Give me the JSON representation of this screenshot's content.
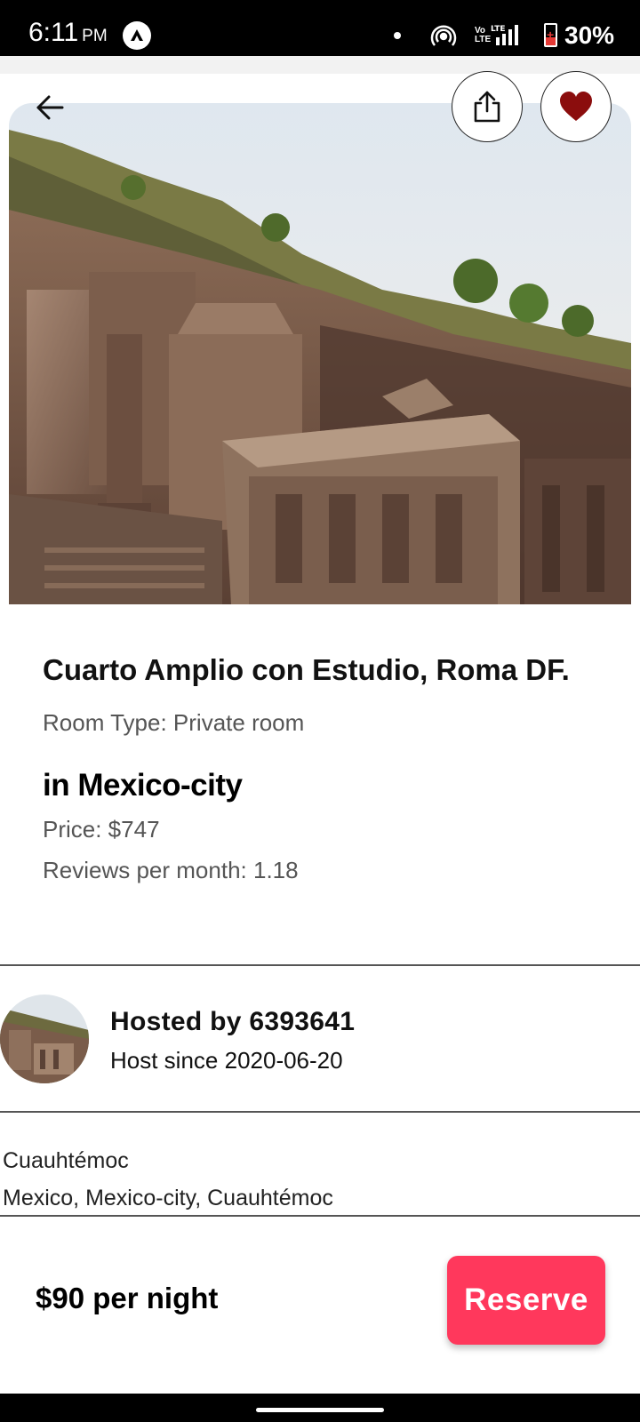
{
  "status_bar": {
    "time": "6:11",
    "ampm": "PM",
    "network": "LTE",
    "volte": "Vo LTE",
    "battery": "30%"
  },
  "header": {
    "back_icon": "arrow-left-icon",
    "share_icon": "share-icon",
    "favorite_icon": "heart-icon",
    "favorite_color": "#8b0d0d"
  },
  "listing": {
    "title": "Cuarto Amplio con Estudio, Roma DF.",
    "room_type": "Room Type: Private room",
    "city": "in Mexico-city",
    "price": "Price: $747",
    "reviews": "Reviews per month: 1.18"
  },
  "host": {
    "hosted_by": "Hosted by 6393641",
    "host_since": "Host since 2020-06-20"
  },
  "location": {
    "neighbourhood": "Cuauhtémoc",
    "full": "Mexico, Mexico-city, Cuauhtémoc"
  },
  "footer": {
    "nightly_price": "$90 per night",
    "reserve_label": "Reserve",
    "reserve_color": "#ff385c"
  }
}
